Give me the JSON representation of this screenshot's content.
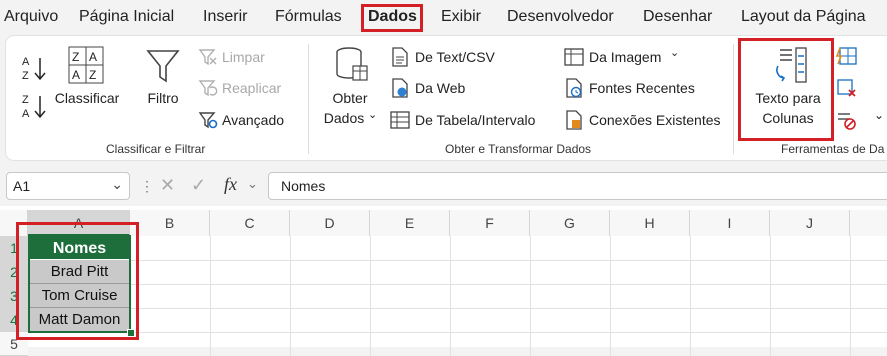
{
  "menu": {
    "tabs": [
      {
        "label": "Arquivo"
      },
      {
        "label": "Página Inicial"
      },
      {
        "label": "Inserir"
      },
      {
        "label": "Fórmulas"
      },
      {
        "label": "Dados"
      },
      {
        "label": "Exibir"
      },
      {
        "label": "Desenvolvedor"
      },
      {
        "label": "Desenhar"
      },
      {
        "label": "Layout da Página"
      }
    ],
    "active_tab": "Dados"
  },
  "ribbon": {
    "sort_filter": {
      "sort_az_label": "A→Z",
      "sort_za_label": "Z→A",
      "sort_button": "Classificar",
      "filter_button": "Filtro",
      "clear": "Limpar",
      "reapply": "Reaplicar",
      "advanced": "Avançado",
      "group_label": "Classificar e Filtrar"
    },
    "get_transform": {
      "get_data_line1": "Obter",
      "get_data_line2": "Dados",
      "from_text_csv": "De Text/CSV",
      "from_web": "Da Web",
      "from_table": "De Tabela/Intervalo",
      "from_image": "Da Imagem",
      "recent_sources": "Fontes Recentes",
      "existing_connections": "Conexões Existentes",
      "group_label": "Obter e Transformar Dados"
    },
    "data_tools": {
      "text_to_columns_line1": "Texto para",
      "text_to_columns_line2": "Colunas",
      "group_label": "Ferramentas de Da"
    }
  },
  "formula_bar": {
    "name_box": "A1",
    "fx": "fx",
    "formula_value": "Nomes"
  },
  "grid": {
    "columns": [
      "A",
      "B",
      "C",
      "D",
      "E",
      "F",
      "G",
      "H",
      "I",
      "J"
    ],
    "rows": [
      "1",
      "2",
      "3",
      "4",
      "5"
    ],
    "cells": {
      "A1": "Nomes",
      "A2": "Brad Pitt",
      "A3": "Tom Cruise",
      "A4": "Matt Damon"
    }
  },
  "colors": {
    "accent_green": "#1e6e3c",
    "highlight_red": "#d32027",
    "data_fill": "#c9c9c9"
  }
}
